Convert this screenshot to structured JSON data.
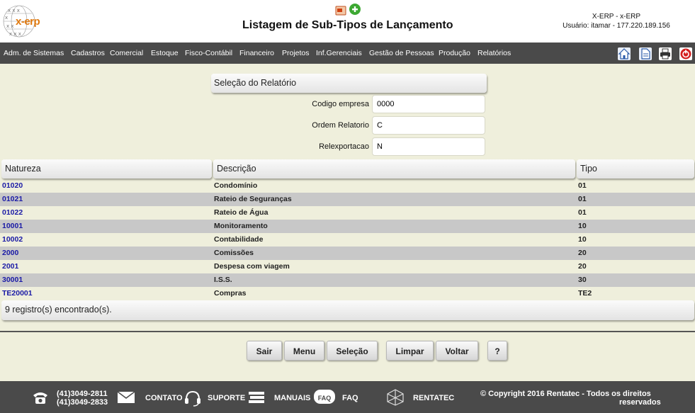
{
  "header": {
    "logo_text": "x-erp",
    "title": "Listagem de Sub-Tipos de Lançamento",
    "system": "X-ERP - x-ERP",
    "user": "Usuário: itamar - 177.220.189.156"
  },
  "menu": {
    "items": [
      "Adm. de Sistemas",
      "Cadastros",
      "Comercial",
      "Estoque",
      "Fisco-Contábil",
      "Financeiro",
      "Projetos",
      "Inf.Gerenciais",
      "Gestão de Pessoas",
      "Produção",
      "Relatórios"
    ]
  },
  "toolbar_icons": [
    "home-icon",
    "document-icon",
    "printer-icon",
    "power-icon"
  ],
  "selection": {
    "title": "Seleção do Relatório",
    "fields": [
      {
        "label": "Codigo empresa",
        "value": "0000"
      },
      {
        "label": "Ordem Relatorio",
        "value": "C"
      },
      {
        "label": "Relexportacao",
        "value": "N"
      }
    ]
  },
  "table": {
    "headers": [
      "Natureza",
      "Descrição",
      "Tipo"
    ],
    "rows": [
      {
        "natureza": "01020",
        "descricao": "Condomínio",
        "tipo": "01"
      },
      {
        "natureza": "01021",
        "descricao": "Rateio de Seguranças",
        "tipo": "01"
      },
      {
        "natureza": "01022",
        "descricao": "Rateio de Água",
        "tipo": "01"
      },
      {
        "natureza": "10001",
        "descricao": "Monitoramento",
        "tipo": "10"
      },
      {
        "natureza": "10002",
        "descricao": "Contabilidade",
        "tipo": "10"
      },
      {
        "natureza": "2000",
        "descricao": "Comissões",
        "tipo": "20"
      },
      {
        "natureza": "2001",
        "descricao": "Despesa com viagem",
        "tipo": "20"
      },
      {
        "natureza": "30001",
        "descricao": "I.S.S.",
        "tipo": "30"
      },
      {
        "natureza": "TE20001",
        "descricao": "Compras",
        "tipo": "TE2"
      }
    ],
    "count_text": "9 registro(s) encontrado(s)."
  },
  "buttons": {
    "sair": "Sair",
    "menu": "Menu",
    "selecao": "Seleção",
    "limpar": "Limpar",
    "voltar": "Voltar",
    "help": "?"
  },
  "footer": {
    "phone1": "(41)3049-2811",
    "phone2": "(41)3049-2833",
    "contato": "CONTATO",
    "suporte": "SUPORTE",
    "manuais": "MANUAIS",
    "faq_badge": "FAQ",
    "faq": "FAQ",
    "rentatec": "RENTATEC",
    "copyright_line1": "© Copyright 2016 Rentatec - Todos os direitos",
    "copyright_line2": "reservados"
  },
  "colors": {
    "background": "#efefdc",
    "bar": "#4a4a4a",
    "link": "#1a1aa6",
    "row_alt": "#c8c8c8",
    "logo": "#e07a10"
  }
}
